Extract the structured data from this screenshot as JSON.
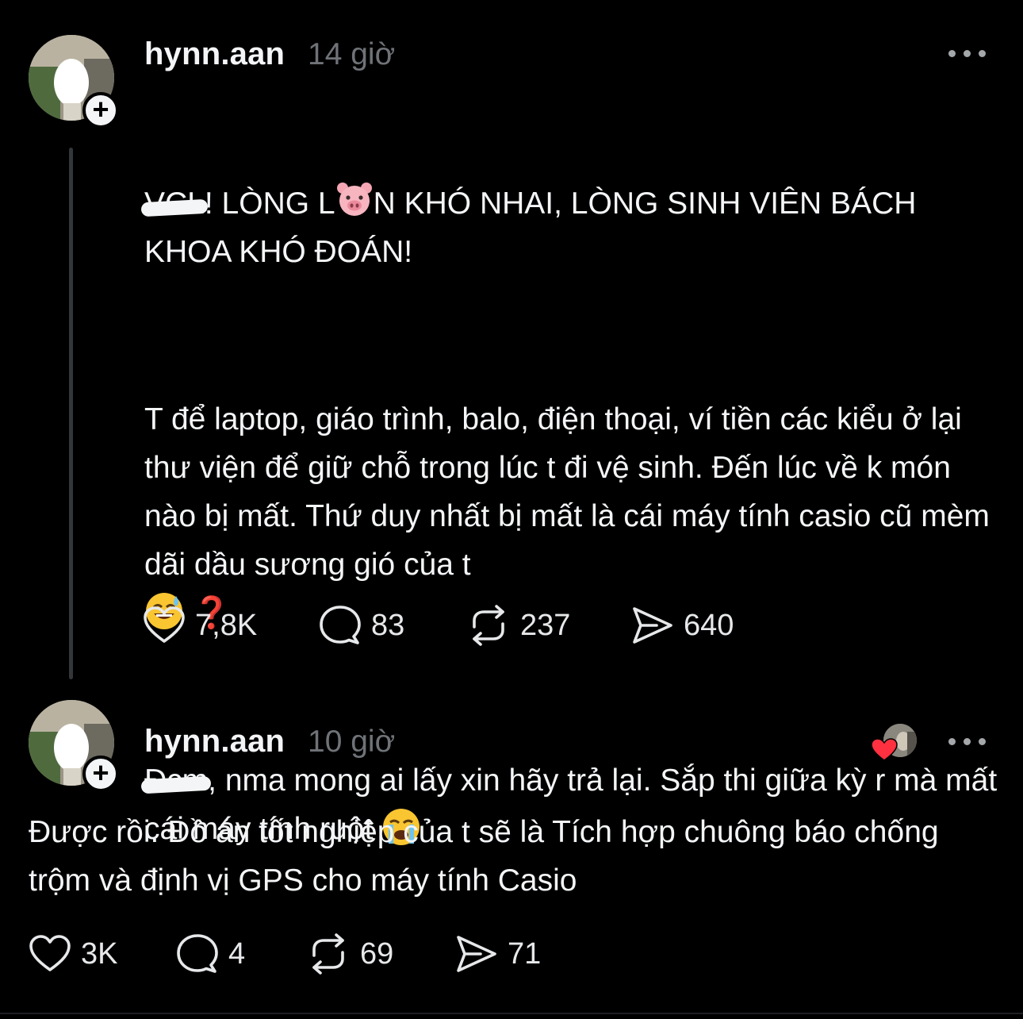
{
  "posts": [
    {
      "username": "hynn.aan",
      "time": "14 giờ",
      "headline_redacted": "VCL",
      "headline_after_redact": "! LÒNG L",
      "headline_pig": "🐷",
      "headline_rest": "N KHÓ NHAI, LÒNG SINH VIÊN BÁCH KHOA KHÓ ĐOÁN!",
      "para1": "T để laptop, giáo trình, balo, điện thoại, ví tiền các kiểu ở lại thư viện để giữ chỗ trong lúc t đi vệ sinh. Đến lúc về k món nào bị mất. Thứ duy nhất bị mất là cái máy tính casio cũ mèm dãi dầu sương gió của t",
      "para1_emoji_face": "😅",
      "para1_emoji_question": "❓",
      "para2_redacted": "Đcm",
      "para2_rest": ", nma mong ai lấy xin hãy trả lại. Sắp thi giữa kỳ r mà mất cái máy tính ruột",
      "para2_emoji": "😭",
      "likes": "7,8K",
      "comments": "83",
      "reposts": "237",
      "shares": "640"
    },
    {
      "username": "hynn.aan",
      "time": "10 giờ",
      "text": "Được rồi. Đồ án tốt nghiệp của t sẽ là Tích hợp chuông báo chống trộm và định vị GPS cho máy tính Casio",
      "likes": "3K",
      "comments": "4",
      "reposts": "69",
      "shares": "71"
    }
  ],
  "icons": {
    "like": "heart-outline-icon",
    "comment": "speech-bubble-icon",
    "repost": "repost-arrows-icon",
    "share": "paper-plane-icon",
    "more": "ellipsis-icon",
    "follow": "plus-icon",
    "reaction": "red-heart-icon"
  },
  "colors": {
    "background": "#000000",
    "text": "#f3f5f7",
    "muted": "#6f7378",
    "thread_line": "#33363a",
    "reaction_heart": "#ff3040"
  }
}
